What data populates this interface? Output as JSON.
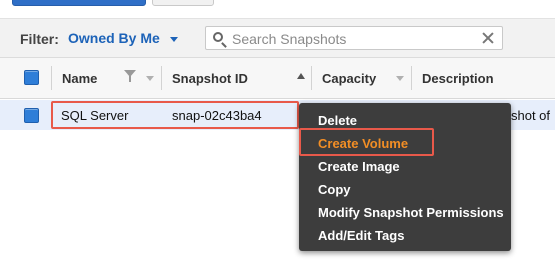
{
  "filter": {
    "label": "Filter:",
    "selected": "Owned By Me",
    "search_placeholder": "Search Snapshots",
    "search_value": ""
  },
  "table": {
    "columns": [
      "Name",
      "Snapshot ID",
      "Capacity",
      "Description"
    ],
    "rows": [
      {
        "name": "SQL Server",
        "snapshot_id": "snap-02c43ba4",
        "description_fragment": "shot of"
      }
    ]
  },
  "context_menu": {
    "items": [
      "Delete",
      "Create Volume",
      "Create Image",
      "Copy",
      "Modify Snapshot Permissions",
      "Add/Edit Tags"
    ],
    "active_item": "Create Volume"
  },
  "colors": {
    "accent_blue": "#1d63b8",
    "highlight_red": "#e8594a",
    "menu_active_orange": "#f28e25",
    "menu_bg": "#3d3d3d",
    "selected_row_bg": "#e7eefb"
  },
  "icons": {
    "filter_search": "search-icon",
    "filter_clear": "close-icon",
    "name_filter": "filter-icon"
  }
}
